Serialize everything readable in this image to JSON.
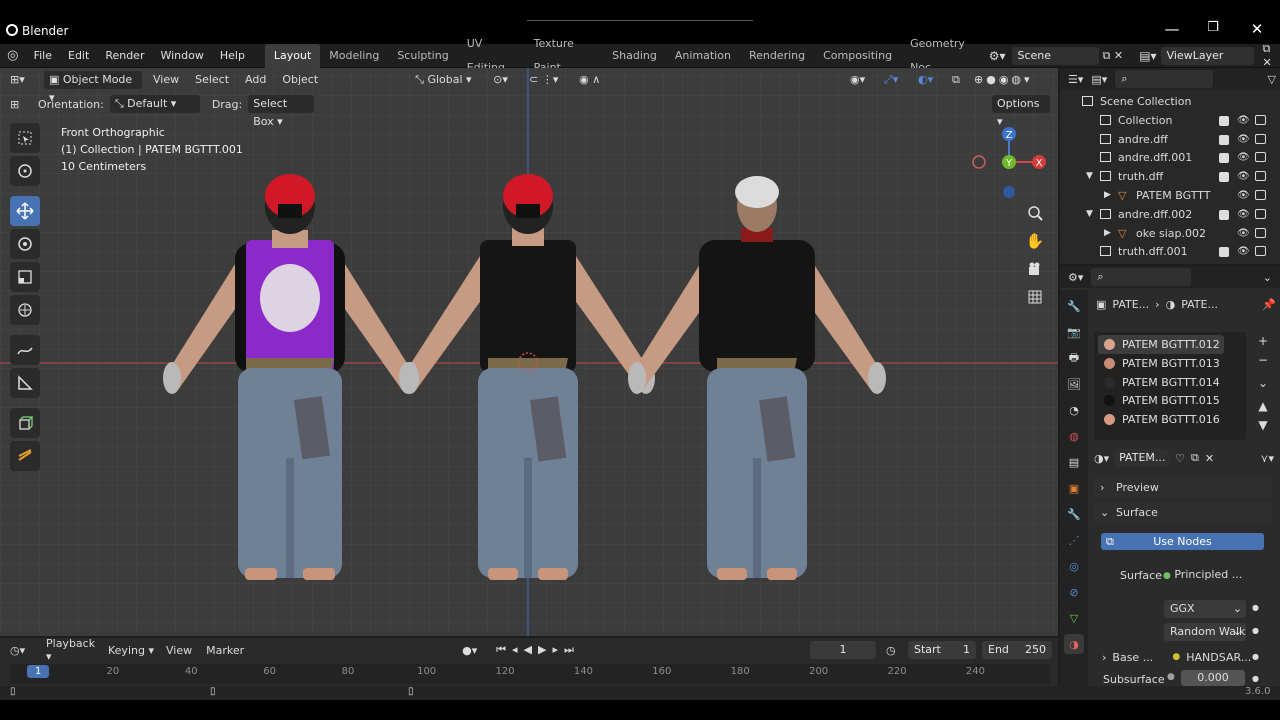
{
  "window": {
    "title": "Blender",
    "version": "3.6.0"
  },
  "menu": {
    "items": [
      "File",
      "Edit",
      "Render",
      "Window",
      "Help"
    ]
  },
  "workspaces": {
    "tabs": [
      "Layout",
      "Modeling",
      "Sculpting",
      "UV Editing",
      "Texture Paint",
      "Shading",
      "Animation",
      "Rendering",
      "Compositing",
      "Geometry Noc"
    ],
    "active": "Layout"
  },
  "scene": {
    "label": "Scene",
    "viewlayer": "ViewLayer"
  },
  "viewport": {
    "mode": "Object Mode",
    "menus": [
      "View",
      "Select",
      "Add",
      "Object"
    ],
    "transform": "Global",
    "orientation_label": "Orientation:",
    "orientation_value": "Default",
    "drag_label": "Drag:",
    "drag_value": "Select Box",
    "options": "Options",
    "overlay": [
      "Front Orthographic",
      "(1) Collection | PATEM BGTTT.001",
      "10 Centimeters"
    ],
    "gizmo": {
      "z": "Z",
      "y": "Y",
      "x": "X"
    }
  },
  "outliner": {
    "rows": [
      {
        "name": "Scene Collection",
        "indent": 0
      },
      {
        "name": "Collection",
        "indent": 1,
        "check": true
      },
      {
        "name": "andre.dff",
        "indent": 1,
        "check": true
      },
      {
        "name": "andre.dff.001",
        "indent": 1,
        "check": true
      },
      {
        "name": "truth.dff",
        "indent": 1,
        "check": true,
        "arrow": "down"
      },
      {
        "name": "PATEM BGTTT",
        "indent": 2,
        "arrow": "right",
        "mesh": true
      },
      {
        "name": "andre.dff.002",
        "indent": 1,
        "check": true,
        "arrow": "down"
      },
      {
        "name": "oke siap.002",
        "indent": 2,
        "arrow": "right",
        "mesh": true
      },
      {
        "name": "truth.dff.001",
        "indent": 1,
        "check": true
      }
    ]
  },
  "properties": {
    "breadcrumb": [
      "PATE...",
      "PATE..."
    ],
    "materials": [
      {
        "name": "PATEM BGTTT.012",
        "color": "#d9a48a"
      },
      {
        "name": "PATEM BGTTT.013",
        "color": "#c98b74"
      },
      {
        "name": "PATEM BGTTT.014",
        "color": "#2b2b2b"
      },
      {
        "name": "PATEM BGTTT.015",
        "color": "#111111"
      },
      {
        "name": "PATEM BGTTT.016",
        "color": "#d69a83"
      }
    ],
    "material_name": "PATEM...",
    "preview": "Preview",
    "surface_panel": "Surface",
    "use_nodes": "Use Nodes",
    "surface_label": "Surface",
    "surface_value": "Principled ...",
    "distribution": "GGX",
    "subsurface_method": "Random Walk",
    "base_label": "Base ...",
    "base_value": "HANDSAR...",
    "subsurface_label": "Subsurface",
    "subsurface_value": "0.000"
  },
  "timeline": {
    "menus": [
      "Playback",
      "Keying",
      "View",
      "Marker"
    ],
    "current_frame": "1",
    "start_label": "Start",
    "start": "1",
    "end_label": "End",
    "end": "250",
    "ticks": [
      "1",
      "20",
      "40",
      "60",
      "80",
      "100",
      "120",
      "140",
      "160",
      "180",
      "200",
      "220",
      "240"
    ]
  }
}
